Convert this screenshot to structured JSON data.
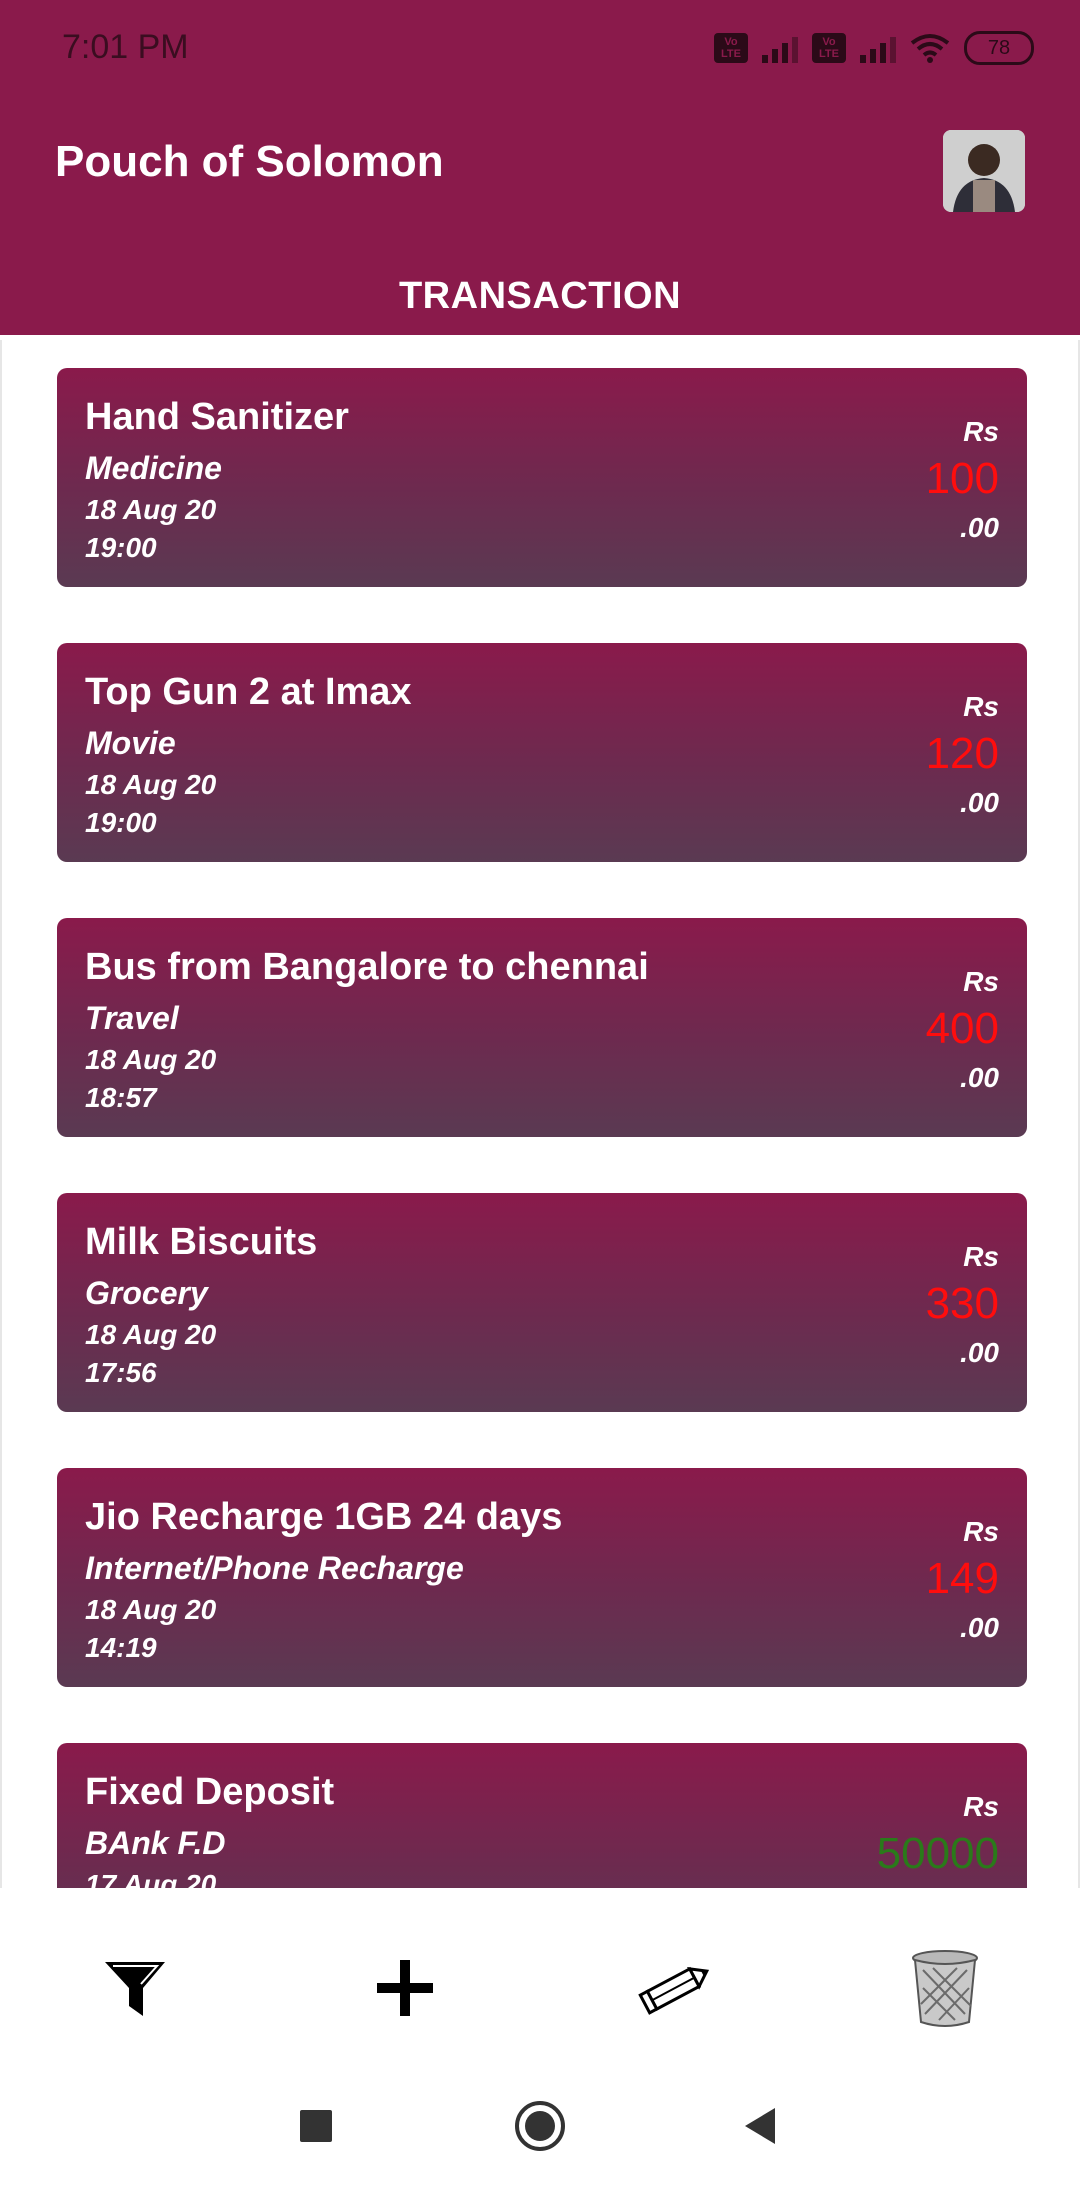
{
  "status": {
    "time": "7:01 PM",
    "lte1": "Vo LTE",
    "lte2": "Vo LTE",
    "battery": "78"
  },
  "header": {
    "title": "Pouch of Solomon",
    "tab": "TRANSACTION"
  },
  "colors": {
    "brand": "#8a1a4b",
    "expense": "#ff0d0d",
    "income": "#2a7a1a"
  },
  "transactions": [
    {
      "title": "Hand Sanitizer",
      "category": "Medicine",
      "date": "18 Aug 20",
      "time": "19:00",
      "currency": "Rs",
      "amount": "100",
      "decimals": ".00",
      "type": "expense"
    },
    {
      "title": "Top Gun 2 at Imax",
      "category": "Movie",
      "date": "18 Aug 20",
      "time": "19:00",
      "currency": "Rs",
      "amount": "120",
      "decimals": ".00",
      "type": "expense"
    },
    {
      "title": "Bus from Bangalore to chennai",
      "category": "Travel",
      "date": "18 Aug 20",
      "time": "18:57",
      "currency": "Rs",
      "amount": "400",
      "decimals": ".00",
      "type": "expense"
    },
    {
      "title": "Milk Biscuits",
      "category": "Grocery",
      "date": "18 Aug 20",
      "time": "17:56",
      "currency": "Rs",
      "amount": "330",
      "decimals": ".00",
      "type": "expense"
    },
    {
      "title": "Jio Recharge 1GB 24 days",
      "category": "Internet/Phone Recharge",
      "date": "18 Aug 20",
      "time": "14:19",
      "currency": "Rs",
      "amount": "149",
      "decimals": ".00",
      "type": "expense"
    },
    {
      "title": "Fixed Deposit",
      "category": "BAnk F.D",
      "date": "17 Aug 20",
      "time": "",
      "currency": "Rs",
      "amount": "50000",
      "decimals": "",
      "type": "income"
    }
  ],
  "toolbar": {
    "filter_icon": "filter-icon",
    "add_icon": "plus-icon",
    "edit_icon": "pencil-icon",
    "delete_icon": "trash-icon"
  },
  "nav": {
    "recents": "square-icon",
    "home": "circle-icon",
    "back": "triangle-icon"
  }
}
